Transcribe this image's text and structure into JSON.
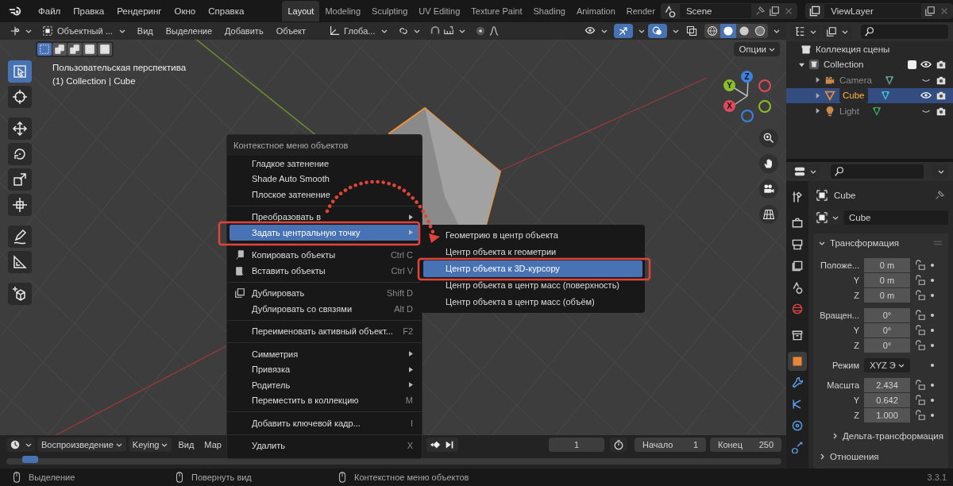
{
  "menubar": {
    "items": [
      "Файл",
      "Правка",
      "Рендеринг",
      "Окно",
      "Справка"
    ]
  },
  "workspaces": [
    {
      "label": "Layout",
      "selected": true
    },
    {
      "label": "Modeling",
      "selected": false
    },
    {
      "label": "Sculpting",
      "selected": false
    },
    {
      "label": "UV Editing",
      "selected": false
    },
    {
      "label": "Texture Paint",
      "selected": false
    },
    {
      "label": "Shading",
      "selected": false
    },
    {
      "label": "Animation",
      "selected": false
    },
    {
      "label": "Render",
      "selected": false
    }
  ],
  "scene": {
    "value": "Scene"
  },
  "view_layer": {
    "value": "ViewLayer"
  },
  "viewport_header": {
    "mode": "Объектный ...",
    "menus": [
      "Вид",
      "Выделение",
      "Добавить",
      "Объект"
    ],
    "orientation": "Глоба...",
    "proportional_editing": false,
    "show_gizmos": true,
    "show_overlays": true,
    "xray": false,
    "shading_modes": [
      {
        "kind": "wireframe",
        "selected": false
      },
      {
        "kind": "solid",
        "selected": true
      },
      {
        "kind": "material",
        "selected": false
      },
      {
        "kind": "rendered",
        "selected": false
      }
    ]
  },
  "select_modes": [
    {
      "kind": "set",
      "selected": true
    },
    {
      "kind": "extend",
      "selected": false
    },
    {
      "kind": "subtract",
      "selected": false
    },
    {
      "kind": "invert",
      "selected": false
    },
    {
      "kind": "intersect",
      "selected": false
    }
  ],
  "viewport": {
    "options": "Опции",
    "view_name": "Пользовательская перспектива",
    "object_info": "(1) Collection | Cube",
    "axes": [
      "Y",
      "Z",
      "X"
    ]
  },
  "toolbar": [
    {
      "kind": "select",
      "selected": true
    },
    {
      "kind": "cursor",
      "selected": false
    },
    {
      "kind": "move",
      "selected": false
    },
    {
      "kind": "rotate",
      "selected": false
    },
    {
      "kind": "scale",
      "selected": false
    },
    {
      "kind": "transform",
      "selected": false
    },
    {
      "kind": "annotate",
      "selected": false
    },
    {
      "kind": "measure",
      "selected": false
    },
    {
      "kind": "add-cube",
      "selected": false
    }
  ],
  "context_menu": {
    "title": "Контекстное меню объектов",
    "groups": [
      [
        {
          "label": "Гладкое затенение",
          "kind": "plain",
          "selected": false
        },
        {
          "label": "Shade Auto Smooth",
          "kind": "plain",
          "selected": false
        },
        {
          "label": "Плоское затенение",
          "kind": "plain",
          "selected": false
        }
      ],
      [
        {
          "label": "Преобразовать в",
          "kind": "submenu",
          "selected": false
        },
        {
          "label": "Задать центральную точку",
          "kind": "submenu",
          "selected": true
        }
      ],
      [
        {
          "label": "Копировать объекты",
          "kind": "copy",
          "shortcut": "Ctrl C",
          "selected": false
        },
        {
          "label": "Вставить объекты",
          "kind": "paste",
          "shortcut": "Ctrl V",
          "selected": false
        }
      ],
      [
        {
          "label": "Дублировать",
          "kind": "duplicate",
          "shortcut": "Shift D",
          "selected": false
        },
        {
          "label": "Дублировать со связями",
          "kind": "plain",
          "shortcut": "Alt D",
          "selected": false
        }
      ],
      [
        {
          "label": "Переименовать активный объект...",
          "kind": "plain",
          "shortcut": "F2",
          "selected": false
        }
      ],
      [
        {
          "label": "Симметрия",
          "kind": "submenu",
          "selected": false
        },
        {
          "label": "Привязка",
          "kind": "submenu",
          "selected": false
        },
        {
          "label": "Родитель",
          "kind": "submenu",
          "selected": false
        },
        {
          "label": "Переместить в коллекцию",
          "kind": "plain",
          "shortcut": "M",
          "selected": false
        }
      ],
      [
        {
          "label": "Добавить ключевой кадр...",
          "kind": "plain",
          "shortcut": "I",
          "selected": false
        }
      ],
      [
        {
          "label": "Удалить",
          "kind": "plain",
          "shortcut": "X",
          "selected": false
        }
      ]
    ]
  },
  "submenu": {
    "items": [
      {
        "label": "Геометрию в центр объекта",
        "selected": false
      },
      {
        "label": "Центр объекта к геометрии",
        "selected": false
      },
      {
        "label": "Центр объекта к 3D-курсору",
        "selected": true
      },
      {
        "label": "Центр объекта в центр масс (поверхность)",
        "selected": false
      },
      {
        "label": "Центр объекта в центр масс (объём)",
        "selected": false
      }
    ]
  },
  "outliner": {
    "tree": [
      {
        "label": "Коллекция сцены",
        "kind": "scene",
        "children": [
          {
            "label": "Collection",
            "kind": "collection",
            "expanded": true,
            "checked": true,
            "visible": true,
            "children": [
              {
                "label": "Camera",
                "kind": "camera",
                "expanded": false,
                "selected": false,
                "visible": false
              },
              {
                "label": "Cube",
                "kind": "mesh",
                "expanded": false,
                "selected": true,
                "visible": true
              },
              {
                "label": "Light",
                "kind": "light",
                "expanded": false,
                "selected": false,
                "visible": false
              }
            ]
          }
        ]
      }
    ]
  },
  "properties": {
    "tabs": [
      {
        "kind": "tool",
        "selected": false
      },
      {
        "kind": "render",
        "selected": false
      },
      {
        "kind": "output",
        "selected": false
      },
      {
        "kind": "view-layer",
        "selected": false
      },
      {
        "kind": "scene",
        "selected": false
      },
      {
        "kind": "world",
        "selected": false
      },
      {
        "kind": "collection",
        "selected": false
      },
      {
        "kind": "object",
        "selected": true
      },
      {
        "kind": "modifiers",
        "selected": false
      },
      {
        "kind": "particles",
        "selected": false
      },
      {
        "kind": "physics",
        "selected": false
      },
      {
        "kind": "constraints",
        "selected": false
      }
    ],
    "object_name": "Cube",
    "data_name": "Cube",
    "panel": "Трансформация",
    "panel_expanded": true,
    "rows": [
      {
        "label": "Положе...",
        "value": "0 m",
        "kind": "number",
        "group_start": true
      },
      {
        "label": "Y",
        "value": "0 m",
        "kind": "number",
        "group_start": false
      },
      {
        "label": "Z",
        "value": "0 m",
        "kind": "number",
        "group_start": false
      },
      {
        "label": "Вращен...",
        "value": "0°",
        "kind": "number",
        "group_start": true
      },
      {
        "label": "Y",
        "value": "0°",
        "kind": "number",
        "group_start": false
      },
      {
        "label": "Z",
        "value": "0°",
        "kind": "number",
        "group_start": false
      },
      {
        "label": "Режим",
        "value": "XYZ Э",
        "kind": "dropdown",
        "group_start": true
      },
      {
        "label": "Масшта",
        "value": "2.434",
        "kind": "number",
        "group_start": true
      },
      {
        "label": "Y",
        "value": "0.642",
        "kind": "number",
        "group_start": false
      },
      {
        "label": "Z",
        "value": "1.000",
        "kind": "number",
        "group_start": false
      }
    ],
    "subpanels": [
      "Дельта-трансформация",
      "Отношения"
    ]
  },
  "timeline": {
    "menus": [
      "Воспроизведение",
      "Keying",
      "Вид",
      "Мар"
    ],
    "frame": "1",
    "start_label": "Начало",
    "start": "1",
    "end_label": "Конец",
    "end": "250"
  },
  "status_bar": {
    "hints": [
      "Выделение",
      "Повернуть вид",
      "Контекстное меню объектов"
    ],
    "version": "3.3.1"
  }
}
